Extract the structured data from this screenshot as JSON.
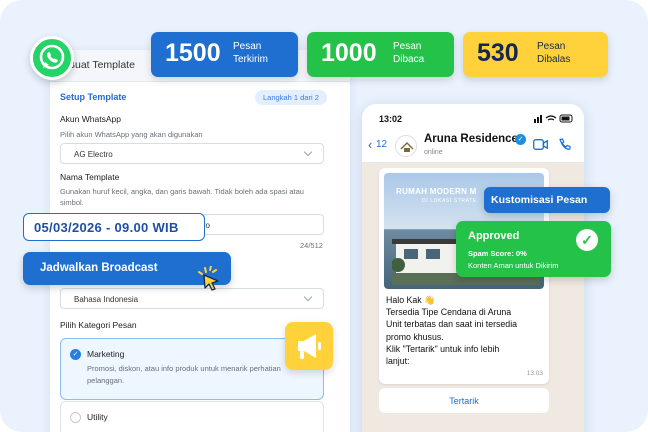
{
  "panel": {
    "header_title": "Buat Template",
    "setup_title": "Setup Template",
    "step": "Langkah 1 dari 2",
    "account_label": "Akun WhatsApp",
    "account_help": "Pilih akun WhatsApp yang akan digunakan",
    "account_value": "AG Electro",
    "name_label": "Nama Template",
    "name_help": "Gunakan huruf kecil, angka, dan garis bawah. Tidak boleh ada spasi atau simbol.",
    "name_value_fragment": "ro",
    "name_counter": "24/512",
    "language_value": "Bahasa Indonesia",
    "category_label": "Pilih Kategori Pesan",
    "categories": [
      {
        "name": "Marketing",
        "desc": "Promosi, diskon, atau info produk untuk menarik perhatian pelanggan.",
        "selected": true
      },
      {
        "name": "Utility",
        "desc": "",
        "selected": false
      }
    ]
  },
  "stats": [
    {
      "value": "1500",
      "label_line1": "Pesan",
      "label_line2": "Terkirim",
      "color": "#1f6fd0"
    },
    {
      "value": "1000",
      "label_line1": "Pesan",
      "label_line2": "Dibaca",
      "color": "#25c24a"
    },
    {
      "value": "530",
      "label_line1": "Pesan",
      "label_line2": "Dibalas",
      "color": "#ffd23c"
    }
  ],
  "schedule": {
    "datetime": "05/03/2026 - 09.00 WIB",
    "button": "Jadwalkan Broadcast"
  },
  "phone": {
    "time": "13:02",
    "back_count": "12",
    "contact_name": "Aruna Residence",
    "status": "online",
    "banner_title": "RUMAH MODERN M",
    "banner_subtitle": "DI LOKASI STRATE",
    "message_lines": [
      "Halo Kak 👋",
      "Tersedia Tipe Cendana di Aruna",
      "Unit terbatas dan saat ini tersedia",
      "promo khusus.",
      "Klik \"Tertarik\" untuk info lebih",
      "lanjut:"
    ],
    "message_time": "13:03",
    "cta_button": "Tertarik"
  },
  "customize_badge": "Kustomisasi Pesan",
  "approval": {
    "title": "Approved",
    "spam": "Spam Score: 0%",
    "safe": "Konten Aman untuk Dikirim"
  },
  "icons": [
    "whatsapp-icon",
    "megaphone-icon",
    "cursor-icon",
    "verified-icon",
    "video-call-icon",
    "phone-icon",
    "check-icon",
    "chevron-down-icon"
  ]
}
